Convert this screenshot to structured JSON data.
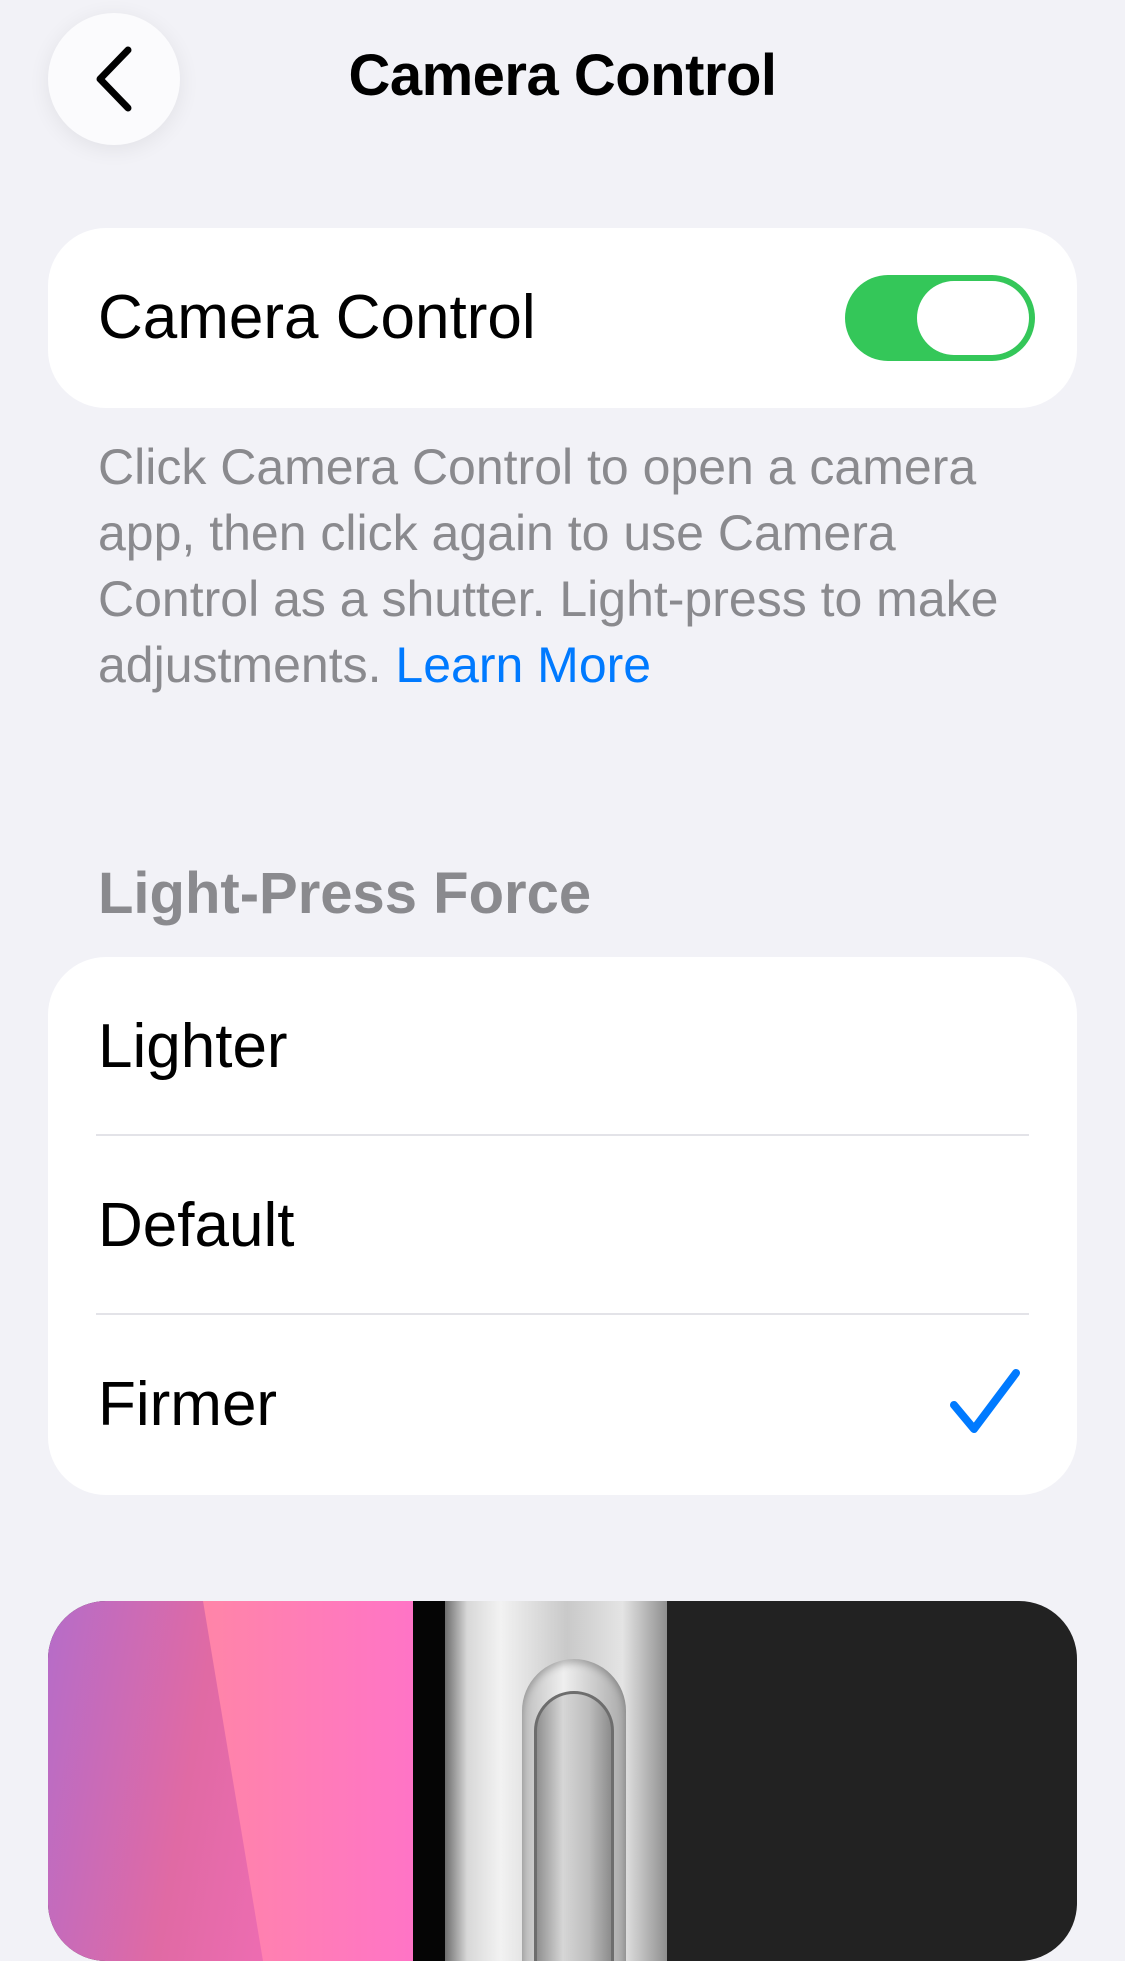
{
  "nav": {
    "title": "Camera Control",
    "back_icon": "chevron-left-icon"
  },
  "toggle": {
    "label": "Camera Control",
    "state": "on",
    "color": "#34c759"
  },
  "footer": {
    "text": "Click Camera Control to open a camera app, then click again to use Camera Control as a shutter. Light-press to make adjustments.",
    "link": "Learn More",
    "text_color": "#8a8a8e",
    "link_color": "#007aff"
  },
  "section": {
    "header": "Light-Press Force"
  },
  "options": [
    {
      "label": "Lighter",
      "selected": false
    },
    {
      "label": "Default",
      "selected": false
    },
    {
      "label": "Firmer",
      "selected": true
    }
  ],
  "colors": {
    "background": "#f2f2f7",
    "accent": "#007aff"
  }
}
